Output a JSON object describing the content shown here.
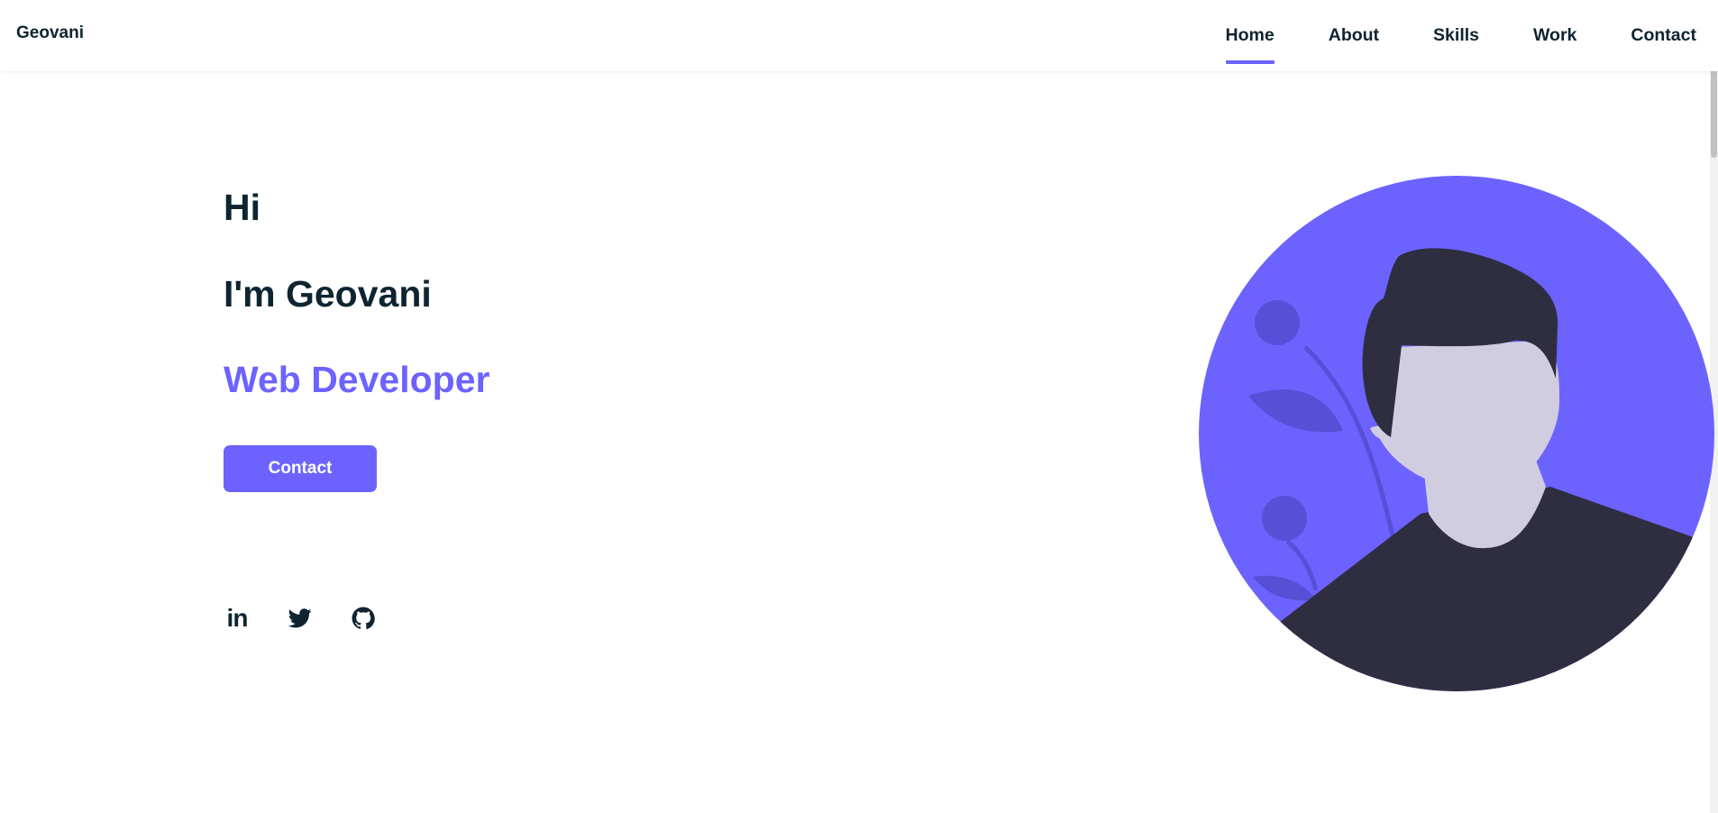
{
  "header": {
    "logo": "Geovani",
    "nav": [
      {
        "label": "Home",
        "active": true
      },
      {
        "label": "About",
        "active": false
      },
      {
        "label": "Skills",
        "active": false
      },
      {
        "label": "Work",
        "active": false
      },
      {
        "label": "Contact",
        "active": false
      }
    ]
  },
  "hero": {
    "greeting": "Hi",
    "name_line": "I'm Geovani",
    "role": "Web Developer",
    "contact_button": "Contact"
  },
  "social": [
    {
      "name": "linkedin",
      "icon": "linkedin-icon",
      "glyph": "in"
    },
    {
      "name": "twitter",
      "icon": "twitter-icon"
    },
    {
      "name": "github",
      "icon": "github-icon"
    }
  ],
  "colors": {
    "accent": "#6c63ff",
    "text": "#0e2431",
    "avatar_dark": "#2f2e41",
    "avatar_skin": "#d0cde1",
    "leaf": "#574fd6"
  }
}
